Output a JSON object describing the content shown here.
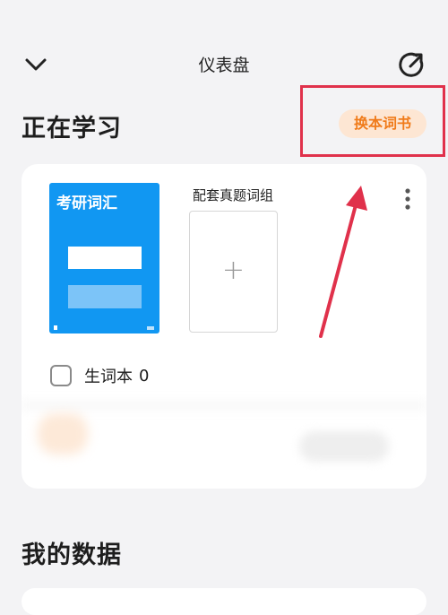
{
  "header": {
    "title": "仪表盘",
    "back_icon": "chevron-down-icon",
    "share_icon": "external-link-icon"
  },
  "learning": {
    "section_title": "正在学习",
    "switch_button": "换本词书",
    "book": {
      "name": "考研词汇",
      "cover_color": "#1197f2"
    },
    "combo_label": "配套真题词组",
    "add_icon": "+",
    "more_icon": "more-vertical-icon",
    "vocab_notebook": {
      "label": "生词本",
      "count": "0"
    }
  },
  "data_section": {
    "section_title": "我的数据"
  },
  "colors": {
    "accent_orange": "#f07b1a",
    "annotation_red": "#e0314b",
    "background": "#f3f3f5"
  }
}
